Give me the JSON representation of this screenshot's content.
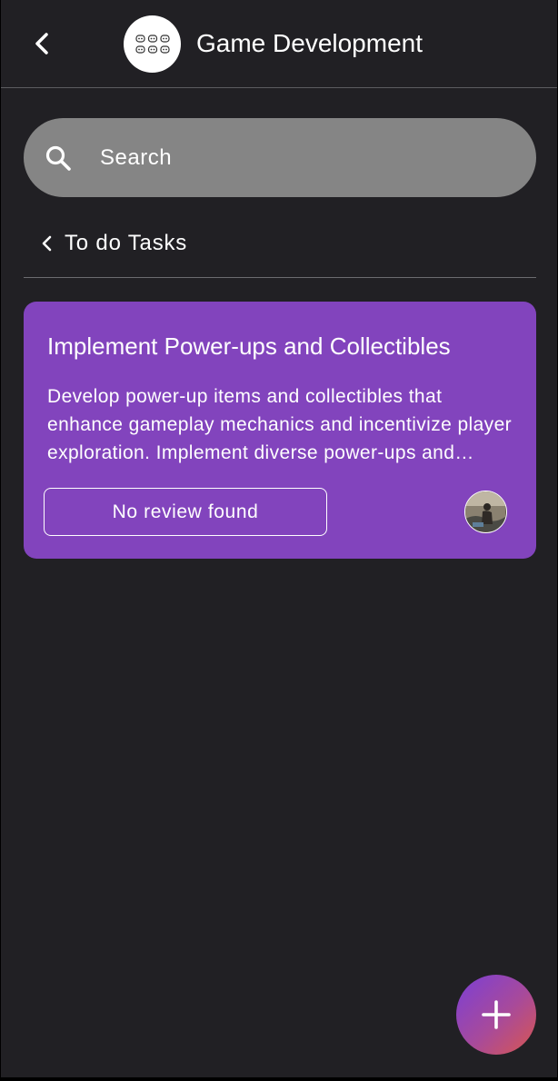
{
  "header": {
    "back_icon": "chevron-left-icon",
    "logo_icon": "game-controllers-icon",
    "title": "Game Development"
  },
  "search": {
    "placeholder": "Search",
    "value": "",
    "icon": "search-icon"
  },
  "section": {
    "chevron_icon": "chevron-left-icon",
    "title": "To do Tasks"
  },
  "tasks": [
    {
      "title": "Implement Power-ups and Collectibles",
      "description": "Develop power-up items and collectibles that enhance gameplay mechanics and incentivize player exploration. Implement diverse power-ups and collectibles.",
      "review_label": "No review found",
      "assignee_icon": "avatar"
    }
  ],
  "fab": {
    "icon": "plus-icon"
  },
  "colors": {
    "background": "#212024",
    "card": "#8244bd",
    "search_bg": "#858585",
    "fab_gradient_start": "#7b3fd6",
    "fab_gradient_end": "#d9574f"
  }
}
